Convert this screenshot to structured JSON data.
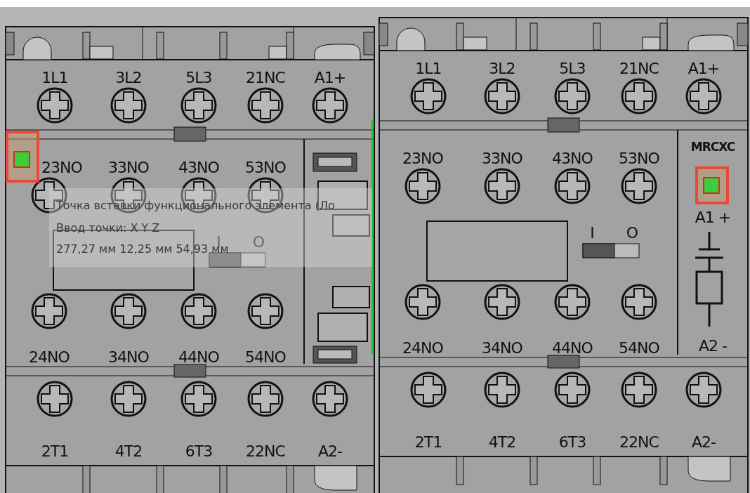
{
  "devices": [
    {
      "top_labels": [
        "1L1",
        "3L2",
        "5L3",
        "21NC",
        "A1+"
      ],
      "middle_labels": [
        "23NO",
        "33NO",
        "43NO",
        "53NO"
      ],
      "switch_labels": [
        "I",
        "O"
      ],
      "lower_labels": [
        "24NO",
        "34NO",
        "44NO",
        "54NO"
      ],
      "bottom_labels": [
        "2T1",
        "4T2",
        "6T3",
        "22NC",
        "A2-"
      ],
      "side": {
        "kind": "slots"
      },
      "snap_marker": true
    },
    {
      "top_labels": [
        "1L1",
        "3L2",
        "5L3",
        "21NC",
        "A1+"
      ],
      "middle_labels": [
        "23NO",
        "33NO",
        "43NO",
        "53NO"
      ],
      "switch_labels": [
        "I",
        "O"
      ],
      "lower_labels": [
        "24NO",
        "34NO",
        "44NO",
        "54NO"
      ],
      "bottom_labels": [
        "2T1",
        "4T2",
        "6T3",
        "22NC",
        "A2-"
      ],
      "side": {
        "kind": "coil",
        "labels": [
          "MRCXC",
          "A1 +",
          "A2 -"
        ]
      },
      "snap_marker": true
    }
  ],
  "tooltip": {
    "title": "Точка вставки функционального элемента (Ло",
    "prompt": "Ввод точки: X Y Z",
    "coordinates": "277,27 мм 12,25 мм 54,93 мм"
  }
}
